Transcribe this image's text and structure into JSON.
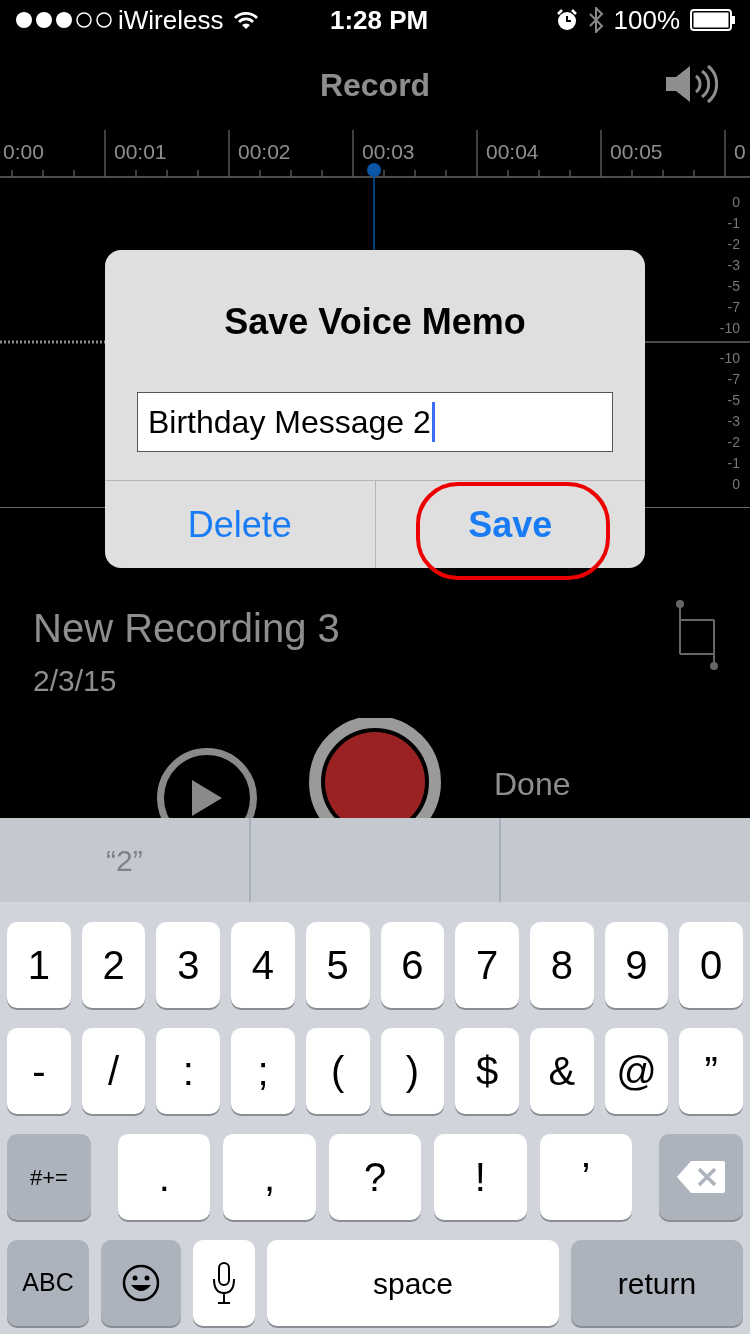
{
  "status_bar": {
    "carrier": "iWireless",
    "time": "1:28 PM",
    "battery": "100%"
  },
  "nav": {
    "title": "Record"
  },
  "timeline": {
    "labels": [
      "0:00",
      "00:01",
      "00:02",
      "00:03",
      "00:04",
      "00:05",
      "0"
    ]
  },
  "level_scale": {
    "upper": [
      "0",
      "-1",
      "-2",
      "-3",
      "-5",
      "-7",
      "-10"
    ],
    "lower": [
      "-10",
      "-7",
      "-5",
      "-3",
      "-2",
      "-1",
      "0"
    ]
  },
  "recording": {
    "name": "New Recording 3",
    "date": "2/3/15"
  },
  "controls": {
    "done": "Done"
  },
  "dialog": {
    "title": "Save Voice Memo",
    "field_value": "Birthday Message 2",
    "buttons": [
      {
        "label": "Delete",
        "kind": "cancel",
        "highlighted": false
      },
      {
        "label": "Save",
        "kind": "default",
        "highlighted": true
      }
    ]
  },
  "keyboard": {
    "suggestions": [
      "“2”"
    ],
    "key_rows": [
      {
        "keys": [
          {
            "kind": "char",
            "label": "1"
          },
          {
            "kind": "char",
            "label": "2"
          },
          {
            "kind": "char",
            "label": "3"
          },
          {
            "kind": "char",
            "label": "4"
          },
          {
            "kind": "char",
            "label": "5"
          },
          {
            "kind": "char",
            "label": "6"
          },
          {
            "kind": "char",
            "label": "7"
          },
          {
            "kind": "char",
            "label": "8"
          },
          {
            "kind": "char",
            "label": "9"
          },
          {
            "kind": "char",
            "label": "0"
          }
        ]
      },
      {
        "keys": [
          {
            "kind": "char",
            "label": "-"
          },
          {
            "kind": "char",
            "label": "/"
          },
          {
            "kind": "char",
            "label": ":"
          },
          {
            "kind": "char",
            "label": ";"
          },
          {
            "kind": "char",
            "label": "("
          },
          {
            "kind": "char",
            "label": ")"
          },
          {
            "kind": "char",
            "label": "$"
          },
          {
            "kind": "char",
            "label": "&"
          },
          {
            "kind": "char",
            "label": "@"
          },
          {
            "kind": "char",
            "label": "”"
          }
        ]
      },
      {
        "keys": [
          {
            "kind": "symbols",
            "label": "#+="
          },
          {
            "kind": "char",
            "label": "."
          },
          {
            "kind": "char",
            "label": ","
          },
          {
            "kind": "char",
            "label": "?"
          },
          {
            "kind": "char",
            "label": "!"
          },
          {
            "kind": "char",
            "label": "’"
          },
          {
            "kind": "backspace"
          }
        ]
      },
      {
        "keys": [
          {
            "kind": "abc",
            "label": "ABC"
          },
          {
            "kind": "emoji"
          },
          {
            "kind": "mic"
          },
          {
            "kind": "space",
            "label": "space"
          },
          {
            "kind": "return",
            "label": "return"
          }
        ]
      }
    ]
  }
}
